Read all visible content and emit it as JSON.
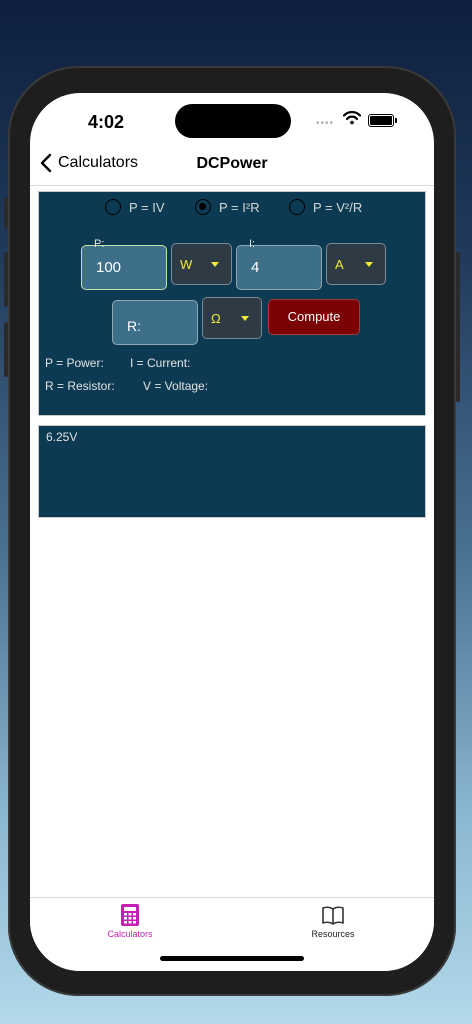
{
  "status": {
    "time": "4:02",
    "signal": "••••"
  },
  "nav": {
    "back_label": "Calculators",
    "title": "DCPower"
  },
  "formulas": [
    {
      "label": "P = IV",
      "selected": false
    },
    {
      "label": "P = I²R",
      "selected": true
    },
    {
      "label": "P = V²/R",
      "selected": false
    }
  ],
  "inputs": {
    "power": {
      "floating_label": "P:",
      "value": "100",
      "unit": "W"
    },
    "current": {
      "floating_label": "I:",
      "value": "4",
      "unit": "A"
    },
    "resistor": {
      "placeholder": "R:",
      "unit": "Ω"
    }
  },
  "compute_label": "Compute",
  "legend": {
    "power": "P = Power:",
    "current": "I = Current:",
    "resistor": "R = Resistor:",
    "voltage": "V = Voltage:"
  },
  "result": "6.25V",
  "tabs": {
    "calculators": "Calculators",
    "resources": "Resources"
  },
  "colors": {
    "panel": "#0b3a52",
    "accent_tab": "#c81eb4",
    "compute": "#7c0303",
    "unit_text": "#f2e83a"
  }
}
